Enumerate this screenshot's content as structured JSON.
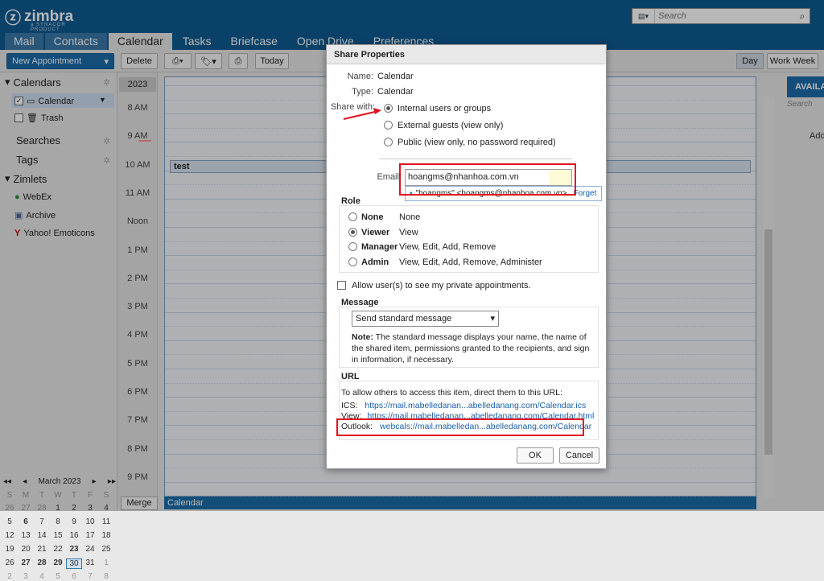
{
  "app": {
    "logo_mark": "ⓩ",
    "logo_word": "zimbra",
    "logo_sub": "a SYNACOR PRODUCT"
  },
  "search": {
    "placeholder": "Search"
  },
  "tabs": [
    "Mail",
    "Contacts",
    "Calendar",
    "Tasks",
    "Briefcase",
    "Open Drive",
    "Preferences"
  ],
  "toolbar": {
    "new_appointment": "New Appointment",
    "delete": "Delete",
    "today": "Today",
    "day": "Day",
    "work_week": "Work Week"
  },
  "sidebar": {
    "calendars": "Calendars",
    "calendar_item": "Calendar",
    "trash": "Trash",
    "searches": "Searches",
    "tags": "Tags",
    "zimlets": "Zimlets",
    "zimlet_items": [
      "WebEx",
      "Archive",
      "Yahoo! Emoticons"
    ]
  },
  "minical": {
    "month": "March 2023",
    "days": [
      "S",
      "M",
      "T",
      "W",
      "T",
      "F",
      "S"
    ],
    "weeks": [
      [
        "26",
        "27",
        "28",
        "1",
        "2",
        "3",
        "4"
      ],
      [
        "5",
        "6",
        "7",
        "8",
        "9",
        "10",
        "11"
      ],
      [
        "12",
        "13",
        "14",
        "15",
        "16",
        "17",
        "18"
      ],
      [
        "19",
        "20",
        "21",
        "22",
        "23",
        "24",
        "25"
      ],
      [
        "26",
        "27",
        "28",
        "29",
        "30",
        "31",
        "1"
      ],
      [
        "2",
        "3",
        "4",
        "5",
        "6",
        "7",
        "8"
      ]
    ]
  },
  "calendar": {
    "year": "2023",
    "times": [
      "8 AM",
      "9 AM",
      "10 AM",
      "11 AM",
      "Noon",
      "1 PM",
      "2 PM",
      "3 PM",
      "4 PM",
      "5 PM",
      "6 PM",
      "7 PM",
      "8 PM",
      "9 PM"
    ],
    "event": "test",
    "bottom": "Calendar",
    "merge": "Merge"
  },
  "right_panel": {
    "title": "AVAILA",
    "search": "Search",
    "add": "Add"
  },
  "dialog": {
    "title": "Share Properties",
    "name_label": "Name:",
    "name_value": "Calendar",
    "type_label": "Type:",
    "type_value": "Calendar",
    "share_with_label": "Share with:",
    "share_options": [
      "Internal users or groups",
      "External guests (view only)",
      "Public (view only, no password required)"
    ],
    "email_label": "Email:",
    "email_value": "hoangms@nhanhoa.com.vn",
    "suggestion": "\"hoangms\" <hoangms@nhanhoa.com.vn>",
    "forget": "Forget",
    "role_title": "Role",
    "roles": [
      {
        "name": "None",
        "desc": "None"
      },
      {
        "name": "Viewer",
        "desc": "View"
      },
      {
        "name": "Manager",
        "desc": "View, Edit, Add, Remove"
      },
      {
        "name": "Admin",
        "desc": "View, Edit, Add, Remove, Administer"
      }
    ],
    "private_label": "Allow user(s) to see my private appointments.",
    "message_title": "Message",
    "message_select": "Send standard message",
    "note_bold": "Note:",
    "note_text": " The standard message displays your name, the name of the shared item, permissions granted to the recipients, and sign in information, if necessary.",
    "url_title": "URL",
    "url_intro": "To allow others to access this item, direct them to this URL:",
    "ics_label": "ICS:",
    "ics_url": "https://mail.mabelledanan...abelledanang.com/Calendar.ics",
    "view_label": "View:",
    "view_url": "https://mail.mabelledanan...abelledanang.com/Calendar.html",
    "outlook_label": "Outlook:",
    "outlook_url": "webcals://mail.mabelledan...abelledanang.com/Calendar",
    "ok": "OK",
    "cancel": "Cancel"
  }
}
